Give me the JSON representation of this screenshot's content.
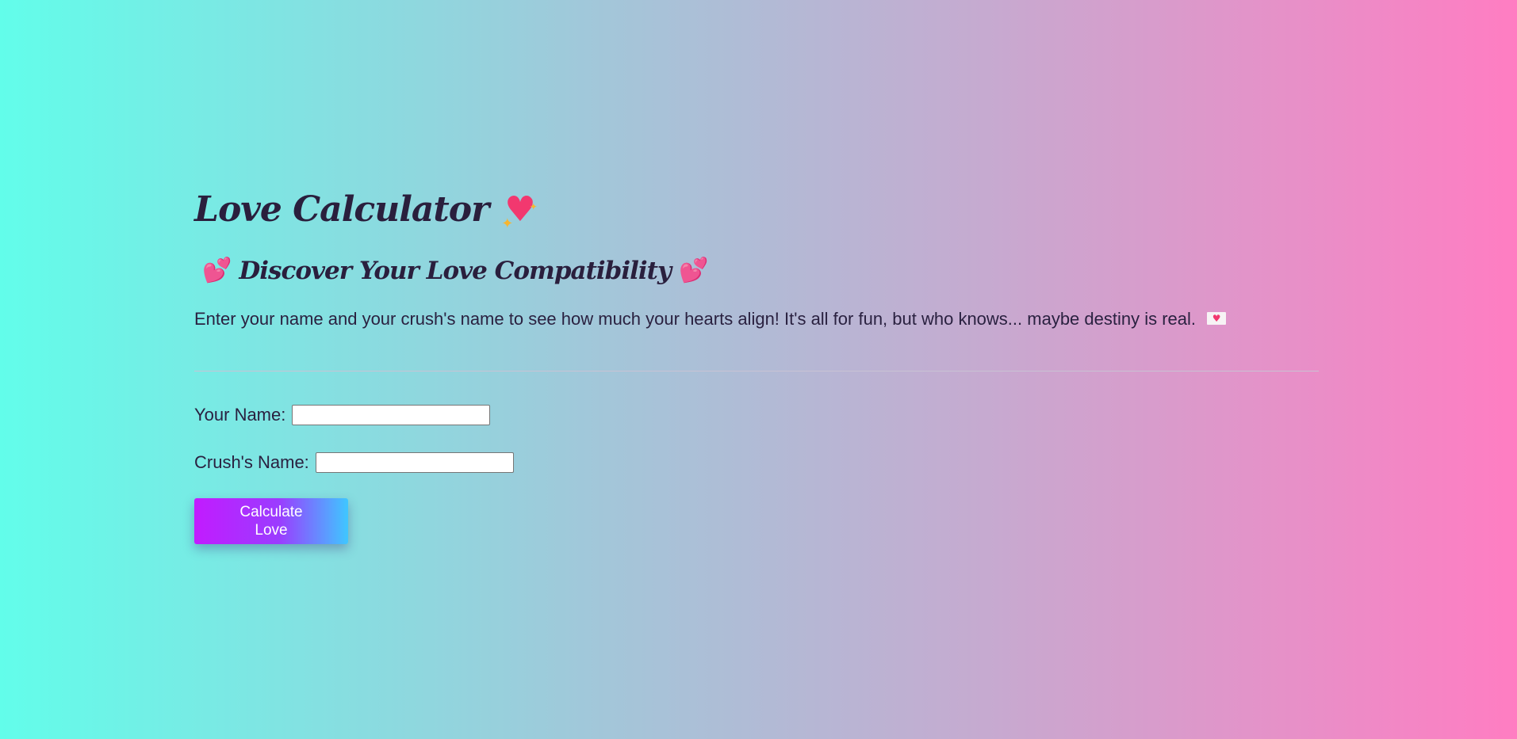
{
  "header": {
    "title": "Love Calculator",
    "title_icon": "sparkling-heart-icon",
    "subtitle": "Discover Your Love Compatibility",
    "subtitle_icon": "two-hearts-icon",
    "intro": "Enter your name and your crush's name to see how much your hearts align! It's all for fun, but who knows... maybe destiny is real.",
    "intro_icon": "love-letter-icon"
  },
  "form": {
    "your_name_label": "Your Name:",
    "your_name_value": "",
    "your_name_placeholder": "",
    "crush_name_label": "Crush's Name:",
    "crush_name_value": "",
    "crush_name_placeholder": "",
    "submit_label": "Calculate Love"
  },
  "colors": {
    "background_left": "#62fdea",
    "background_right": "#ff7dc2",
    "text": "#2a1f3d",
    "button_start": "#c21bff",
    "button_end": "#3fc7ff",
    "heart": "#f2386f"
  }
}
